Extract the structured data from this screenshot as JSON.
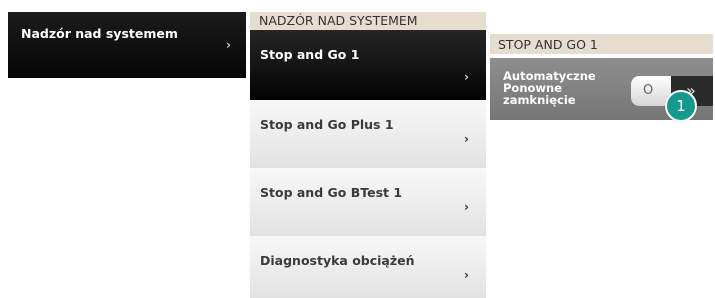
{
  "system_menu": {
    "title": "Nadzór nad systemem",
    "chevron": "›"
  },
  "submenu": {
    "header": "NADZÓR NAD SYSTEMEM",
    "items": [
      {
        "label": "Stop and Go 1",
        "chevron": "›",
        "active": true
      },
      {
        "label": "Stop and Go Plus 1",
        "chevron": "›",
        "active": false
      },
      {
        "label": "Stop and Go BTest 1",
        "chevron": "›",
        "active": false
      },
      {
        "label": "Diagnostyka obciążeń",
        "chevron": "›",
        "active": false
      }
    ]
  },
  "detail": {
    "header": "STOP AND GO 1",
    "setting_label_line1": "Automatyczne",
    "setting_label_line2": "Ponowne",
    "setting_label_line3": "zamknięcie",
    "toggle_state_glyph": "O",
    "toggle_arrows": "»",
    "toggle_on": false
  },
  "callout": {
    "number": "1",
    "color": "#149a8c"
  }
}
